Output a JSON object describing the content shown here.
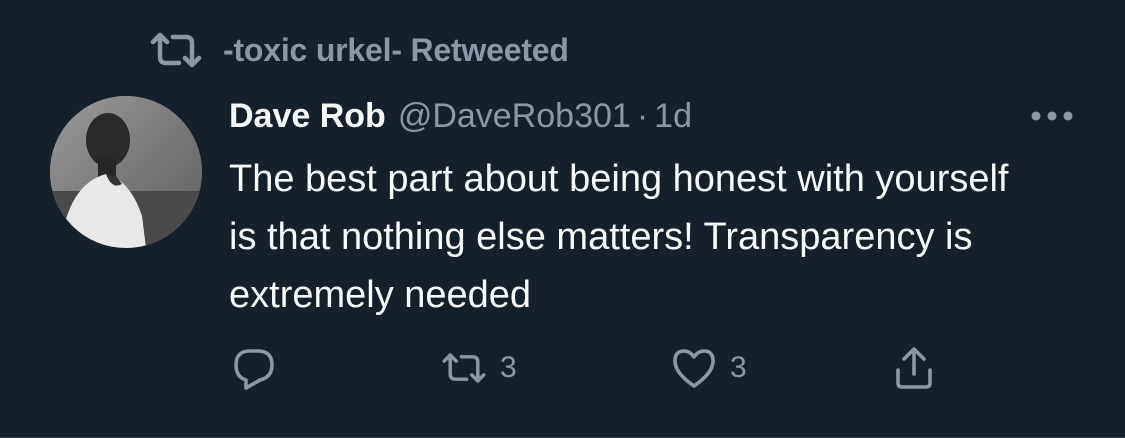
{
  "retweet_context": {
    "label": "-toxic urkel- Retweeted",
    "icon": "retweet-icon"
  },
  "tweet": {
    "display_name": "Dave Rob",
    "handle": "@DaveRob301",
    "separator": "·",
    "time": "1d",
    "text": "The best part about being honest with yourself is that nothing else matters! Transparency is extremely needed",
    "more_icon": "more-icon",
    "avatar": "avatar-photo"
  },
  "actions": {
    "reply": {
      "icon": "reply-icon",
      "count": ""
    },
    "retweet": {
      "icon": "retweet-icon",
      "count": "3"
    },
    "like": {
      "icon": "heart-icon",
      "count": "3"
    },
    "share": {
      "icon": "share-icon"
    }
  },
  "colors": {
    "background": "#15202b",
    "primary_text": "#f7f9f9",
    "secondary_text": "#8b98a5",
    "divider": "#38444d"
  }
}
